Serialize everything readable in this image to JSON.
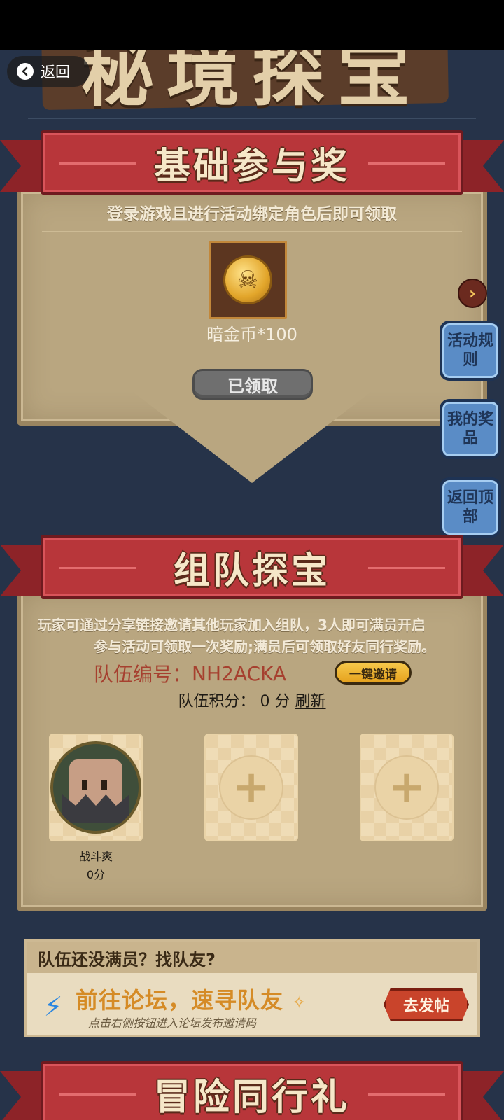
{
  "header": {
    "big_title": "秘境探宝",
    "back_label": "返回"
  },
  "section_basic": {
    "title": "基础参与奖",
    "subtitle": "登录游戏且进行活动绑定角色后即可领取",
    "reward_name": "暗金币*100",
    "reward_icon": "skull-coin-icon",
    "claim_button": "已领取"
  },
  "side_buttons": [
    {
      "label": "活动规则"
    },
    {
      "label": "我的奖品"
    },
    {
      "label": "返回顶部"
    }
  ],
  "section_team": {
    "title": "组队探宝",
    "desc_line1": "玩家可通过分享链接邀请其他玩家加入组队，3人即可满员开启",
    "desc_line2": "参与活动可领取一次奖励;满员后可领取好友同行奖励。",
    "team_id_label": "队伍编号：",
    "team_id_value": "NH2ACKA",
    "invite_button": "一键邀请",
    "score_label": "队伍积分：",
    "score_value": "0 分",
    "refresh_label": "刷新",
    "members": [
      {
        "name": "战斗爽",
        "score": "0分"
      }
    ],
    "empty_slots": 2
  },
  "forum_promo": {
    "header": "队伍还没满员？找队友?",
    "main_text": "前往论坛，速寻队友",
    "arrow": "✧",
    "hint": "点击右侧按钮进入论坛发布邀请码",
    "button": "去发帖"
  },
  "section_adventure": {
    "title": "冒险同行礼"
  },
  "colors": {
    "background": "#263349",
    "ribbon_red": "#b8363a",
    "parchment": "#b9a680",
    "side_button_blue": "#5a8cc6",
    "invite_yellow": "#f6c84a",
    "team_id_red": "#a6402f"
  }
}
